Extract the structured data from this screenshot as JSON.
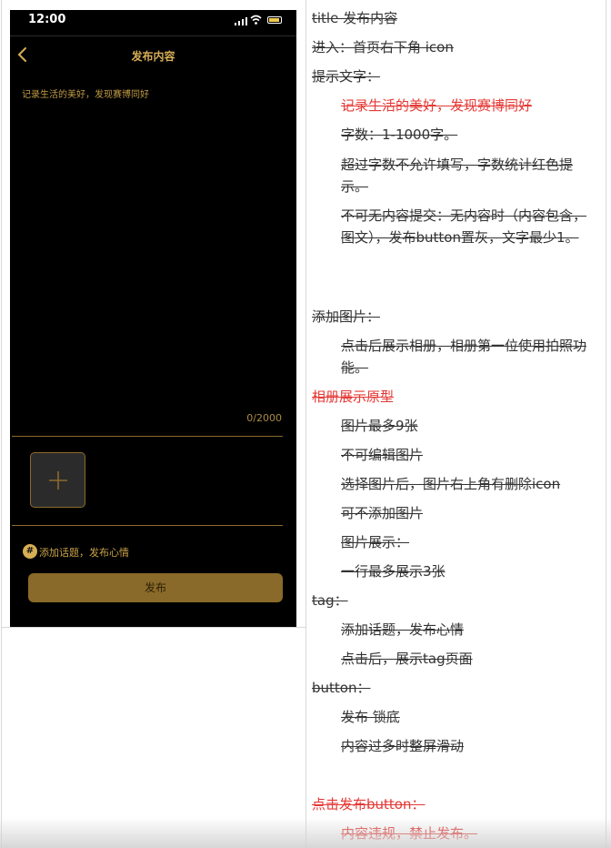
{
  "phone": {
    "status": {
      "time": "12:00"
    },
    "nav": {
      "title": "发布内容"
    },
    "content": {
      "placeholder": "记录生活的美好，发现赛博同好",
      "char_count": "0/2000"
    },
    "topic": {
      "label": "添加话题，发布心情"
    },
    "publish": {
      "label": "发布"
    }
  },
  "spec": {
    "lines": [
      "title 发布内容",
      "进入：首页右下角 icon",
      "提示文字：",
      "记录生活的美好，发现赛博同好",
      "字数：1-1000字。",
      "超过字数不允许填写，字数统计红色提示。",
      "不可无内容提交：无内容时（内容包含，图文），发布button置灰，文字最少1。",
      "添加图片：",
      "点击后展示相册，相册第一位使用拍照功能。",
      "相册展示原型",
      "图片最多9张",
      "不可编辑图片",
      "选择图片后，图片右上角有删除icon",
      "可不添加图片",
      "图片展示：",
      "一行最多展示3张",
      "tag：",
      "添加话题，发布心情",
      "点击后，展示tag页面",
      "button：",
      "发布 锁底",
      "内容过多时整屏滑动",
      "点击发布button：",
      "内容违规，禁止发布。"
    ]
  },
  "colors": {
    "accent": "#c9a24a",
    "warning": "#e53935"
  }
}
